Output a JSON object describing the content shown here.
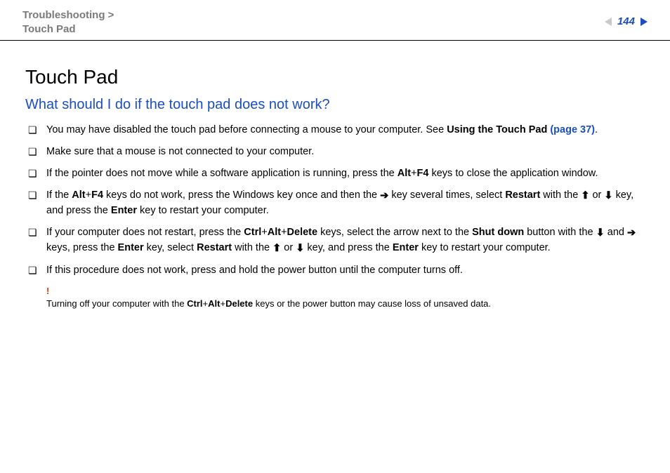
{
  "header": {
    "breadcrumb_line1": "Troubleshooting >",
    "breadcrumb_line2": "Touch Pad",
    "page_number": "144"
  },
  "title": "Touch Pad",
  "question": "What should I do if the touch pad does not work?",
  "bullets": {
    "b0": {
      "pre": "You may have disabled the touch pad before connecting a mouse to your computer. See ",
      "link_label": "Using the Touch Pad ",
      "link_page": "(page 37)",
      "post": "."
    },
    "b1": "Make sure that a mouse is not connected to your computer.",
    "b2": {
      "pre": "If the pointer does not move while a software application is running, press the ",
      "k1": "Alt",
      "plus1": "+",
      "k2": "F4",
      "post": " keys to close the application window."
    },
    "b3": {
      "p1": "If the ",
      "k1": "Alt",
      "plus1": "+",
      "k2": "F4",
      "p2": " keys do not work, press the Windows key once and then the ",
      "arrow_right": "➔",
      "p3": " key several times, select ",
      "k3": "Restart",
      "p4": " with the ",
      "arrow_up": "⬆",
      "p5": " or ",
      "arrow_down": "⬇",
      "p6": " key, and press the ",
      "k4": "Enter",
      "p7": " key to restart your computer."
    },
    "b4": {
      "p1": "If your computer does not restart, press the ",
      "k1": "Ctrl",
      "plus1": "+",
      "k2": "Alt",
      "plus2": "+",
      "k3": "Delete",
      "p2": " keys, select the arrow next to the ",
      "k4": "Shut down",
      "p3": " button with the ",
      "arrow_down": "⬇",
      "p4": " and ",
      "arrow_right": "➔",
      "p5": " keys, press the ",
      "k5": "Enter",
      "p6": " key, select ",
      "k6": "Restart",
      "p7": " with the ",
      "arrow_up": "⬆",
      "p8": " or ",
      "arrow_down2": "⬇",
      "p9": " key, and press the ",
      "k7": "Enter",
      "p10": " key to restart your computer."
    },
    "b5": "If this procedure does not work, press and hold the power button until the computer turns off."
  },
  "warning": {
    "mark": "!",
    "pre": "Turning off your computer with the ",
    "k1": "Ctrl",
    "plus1": "+",
    "k2": "Alt",
    "plus2": "+",
    "k3": "Delete",
    "post": " keys or the power button may cause loss of unsaved data."
  }
}
